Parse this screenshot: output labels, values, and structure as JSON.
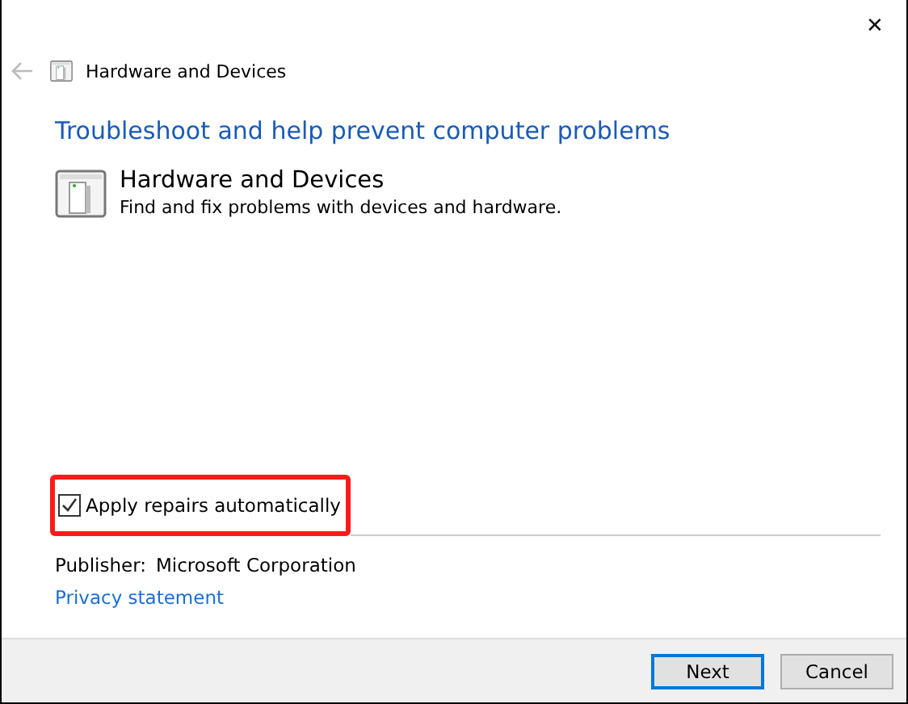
{
  "window": {
    "close_glyph": "✕"
  },
  "nav": {
    "back_disabled": true,
    "title": "Hardware and Devices"
  },
  "heading": "Troubleshoot and help prevent computer problems",
  "troubleshooter": {
    "title": "Hardware and Devices",
    "description": "Find and fix problems with devices and hardware."
  },
  "auto_repair": {
    "label": "Apply repairs automatically",
    "checked": true,
    "highlighted": true
  },
  "publisher": {
    "label": "Publisher:",
    "value": "Microsoft Corporation"
  },
  "privacy_link": "Privacy statement",
  "buttons": [
    {
      "label": "Next",
      "default": true
    },
    {
      "label": "Cancel",
      "default": false
    }
  ]
}
